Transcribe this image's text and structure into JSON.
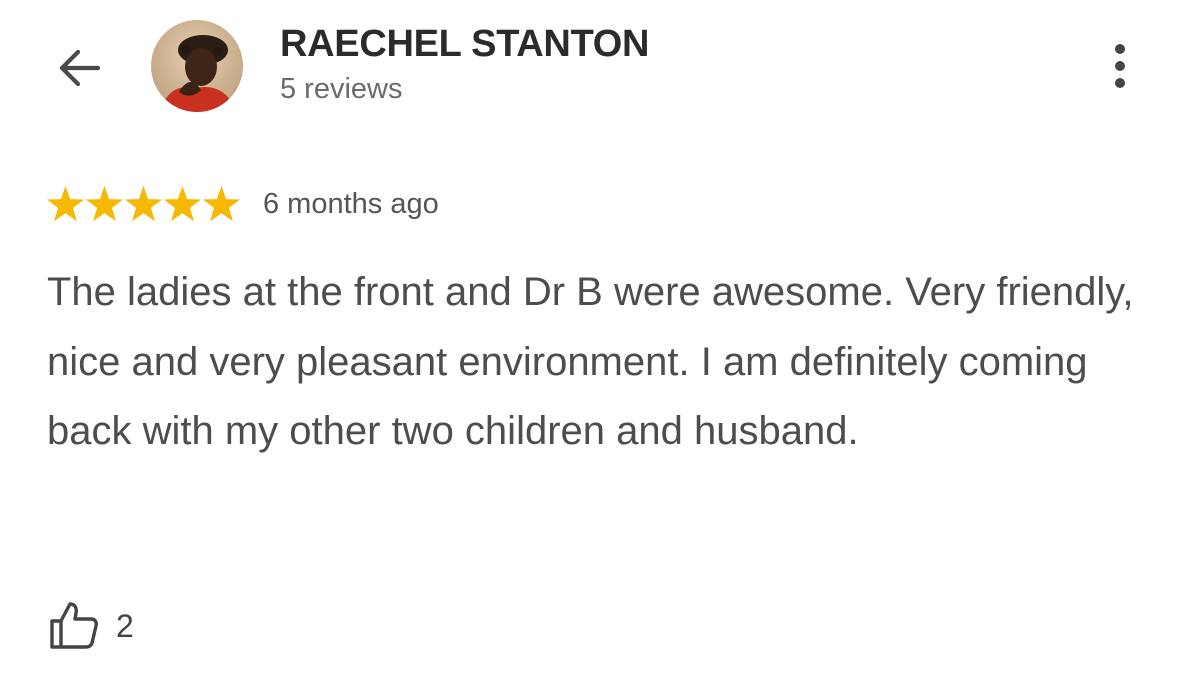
{
  "header": {
    "reviewer_name": "RAECHEL STANTON",
    "review_count": "5 reviews",
    "icons": {
      "back": "arrow-left-icon",
      "more": "vertical-dots-icon"
    }
  },
  "review": {
    "rating": 5,
    "rating_max": 5,
    "time_ago": "6 months ago",
    "text": "The ladies at the front and Dr B were awesome. Very friendly, nice and very pleasant environment. I am definitely coming back with my other two children and husband.",
    "like_count": "2",
    "like_icon": "thumbs-up-icon"
  },
  "colors": {
    "star": "#F6B800",
    "name": "#2B2B2B",
    "secondary_text": "#6B6B6B",
    "body_text": "#4D4D4D",
    "icon": "#444444"
  }
}
